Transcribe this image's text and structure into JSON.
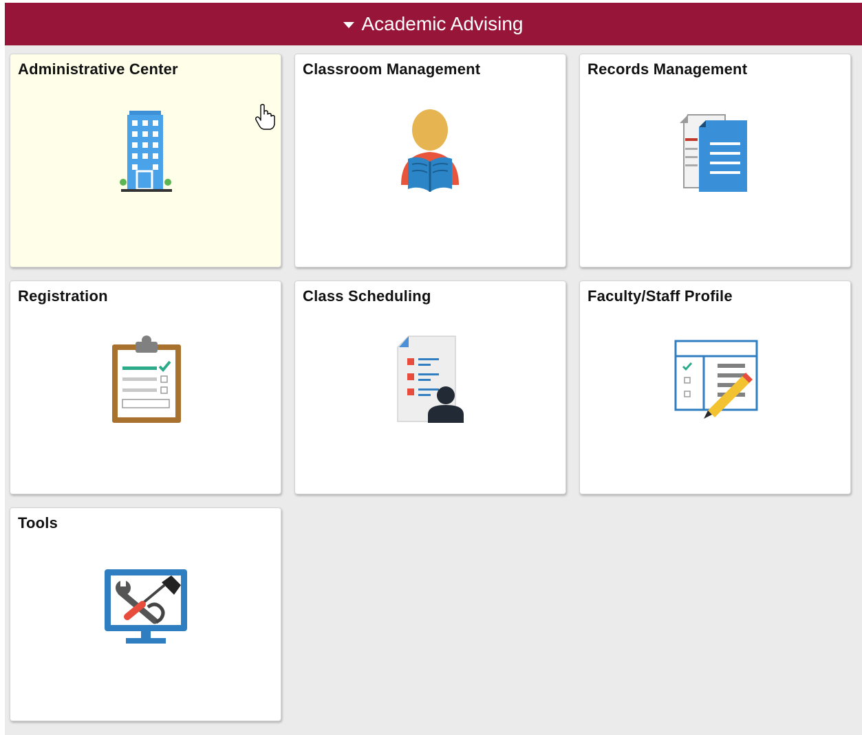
{
  "header": {
    "title": "Academic Advising",
    "icon": "caret-down-icon",
    "color": "#961538"
  },
  "tiles": [
    {
      "label": "Administrative Center",
      "icon": "office-building-icon"
    },
    {
      "label": "Classroom Management",
      "icon": "person-reading-book-icon"
    },
    {
      "label": "Records Management",
      "icon": "documents-icon"
    },
    {
      "label": "Registration",
      "icon": "clipboard-checklist-icon"
    },
    {
      "label": "Class Scheduling",
      "icon": "schedule-document-person-icon"
    },
    {
      "label": "Faculty/Staff Profile",
      "icon": "profile-form-pencil-icon"
    },
    {
      "label": "Tools",
      "icon": "monitor-tools-icon"
    }
  ],
  "colors": {
    "hover_tile": "#fefee9",
    "background": "#ebebeb"
  }
}
